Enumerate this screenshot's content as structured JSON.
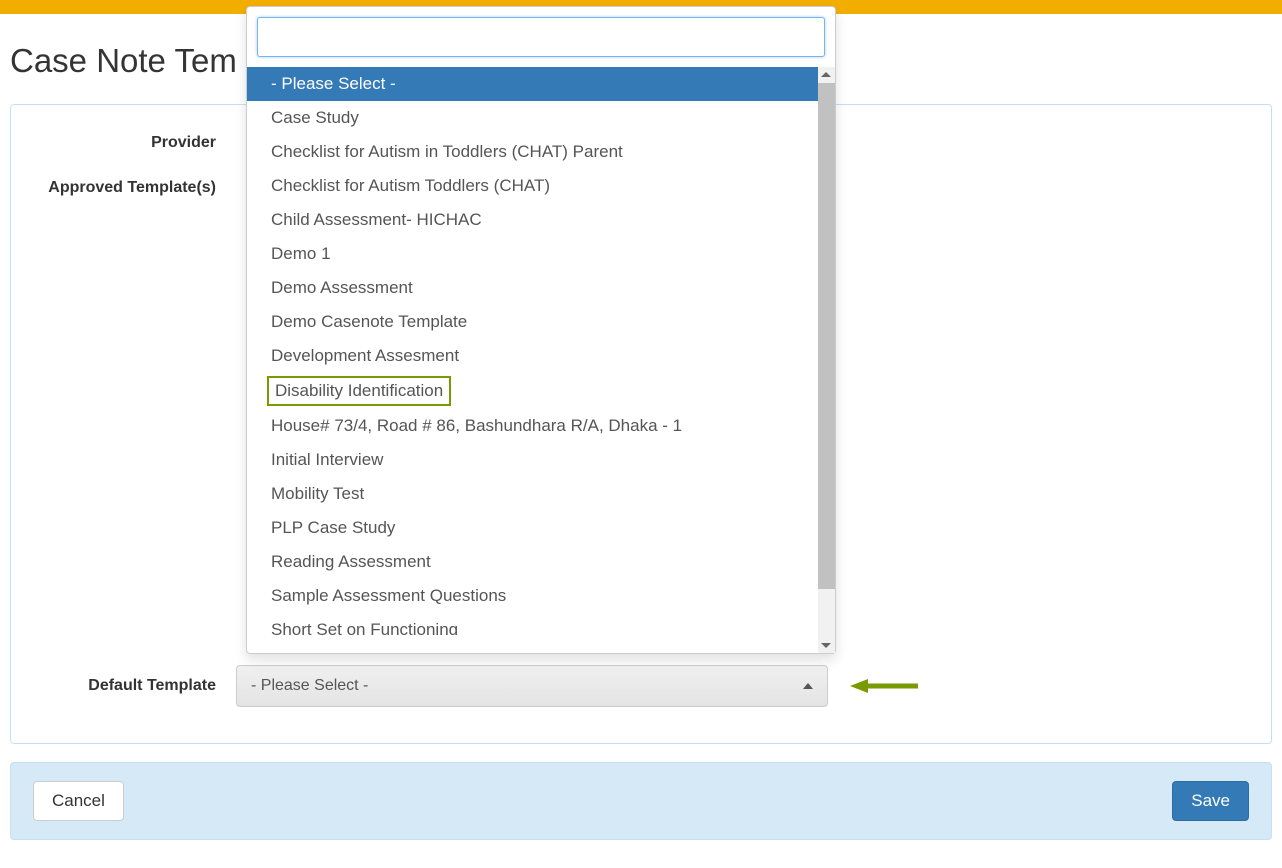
{
  "page": {
    "title": "Case Note Tem"
  },
  "labels": {
    "provider": "Provider",
    "approved_templates": "Approved Template(s)",
    "default_template": "Default Template"
  },
  "default_select": {
    "value": "- Please Select -"
  },
  "dropdown": {
    "search_value": "",
    "items": [
      {
        "label": "- Please Select -",
        "selected": true,
        "highlighted": false
      },
      {
        "label": "Case Study",
        "selected": false,
        "highlighted": false
      },
      {
        "label": "Checklist for Autism in Toddlers (CHAT) Parent",
        "selected": false,
        "highlighted": false
      },
      {
        "label": "Checklist for Autism Toddlers (CHAT)",
        "selected": false,
        "highlighted": false
      },
      {
        "label": "Child Assessment- HICHAC",
        "selected": false,
        "highlighted": false
      },
      {
        "label": "Demo 1",
        "selected": false,
        "highlighted": false
      },
      {
        "label": "Demo Assessment",
        "selected": false,
        "highlighted": false
      },
      {
        "label": "Demo Casenote Template",
        "selected": false,
        "highlighted": false
      },
      {
        "label": "Development Assesment",
        "selected": false,
        "highlighted": false
      },
      {
        "label": "Disability Identification",
        "selected": false,
        "highlighted": true
      },
      {
        "label": "House# 73/4, Road # 86, Bashundhara R/A, Dhaka - 1",
        "selected": false,
        "highlighted": false
      },
      {
        "label": "Initial Interview",
        "selected": false,
        "highlighted": false
      },
      {
        "label": "Mobility Test",
        "selected": false,
        "highlighted": false
      },
      {
        "label": "PLP Case Study",
        "selected": false,
        "highlighted": false
      },
      {
        "label": "Reading Assessment",
        "selected": false,
        "highlighted": false
      },
      {
        "label": "Sample Assessment Questions",
        "selected": false,
        "highlighted": false
      },
      {
        "label": "Short Set on Functioning",
        "selected": false,
        "highlighted": false
      }
    ]
  },
  "buttons": {
    "cancel": "Cancel",
    "save": "Save"
  },
  "colors": {
    "accent_orange": "#f2ae00",
    "primary_blue": "#337ab7",
    "highlight_olive": "#7a9a01"
  }
}
